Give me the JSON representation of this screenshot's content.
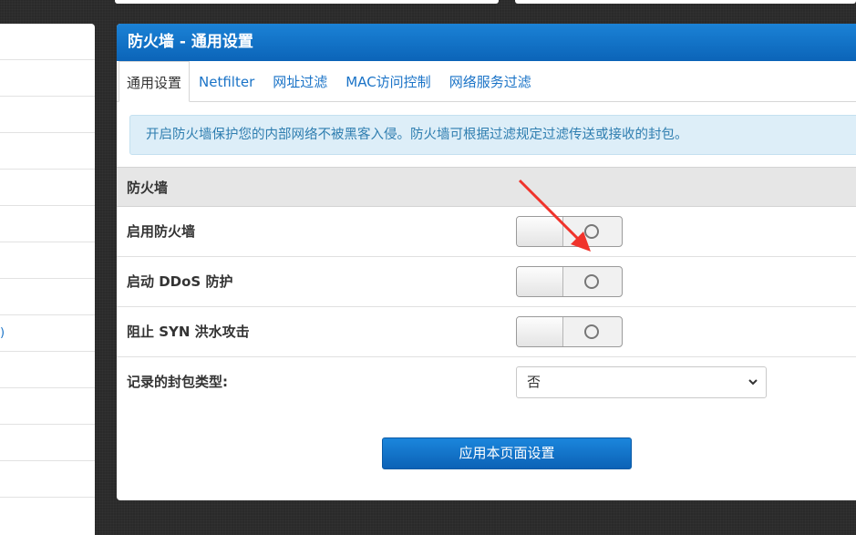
{
  "sidebar": {
    "items": [
      "",
      "",
      "",
      "",
      "",
      "",
      "",
      "",
      ")",
      "",
      "",
      "",
      ""
    ]
  },
  "panel": {
    "title": "防火墙 - 通用设置",
    "tabs": [
      {
        "label": "通用设置",
        "active": true
      },
      {
        "label": "Netfilter",
        "active": false
      },
      {
        "label": "网址过滤",
        "active": false
      },
      {
        "label": "MAC访问控制",
        "active": false
      },
      {
        "label": "网络服务过滤",
        "active": false
      }
    ],
    "info_text": "开启防火墙保护您的内部网络不被黑客入侵。防火墙可根据过滤规定过滤传送或接收的封包。",
    "section_title": "防火墙",
    "rows": {
      "firewall_label": "启用防火墙",
      "ddos_label": "启动 DDoS 防护",
      "syn_label": "阻止 SYN 洪水攻击",
      "log_label": "记录的封包类型:"
    },
    "log_select_value": "否",
    "apply_label": "应用本页面设置"
  },
  "colors": {
    "header_blue": "#0b64b8",
    "link_blue": "#1a73c7",
    "info_bg": "#ddeef8",
    "annotation_arrow": "#f0332b"
  }
}
